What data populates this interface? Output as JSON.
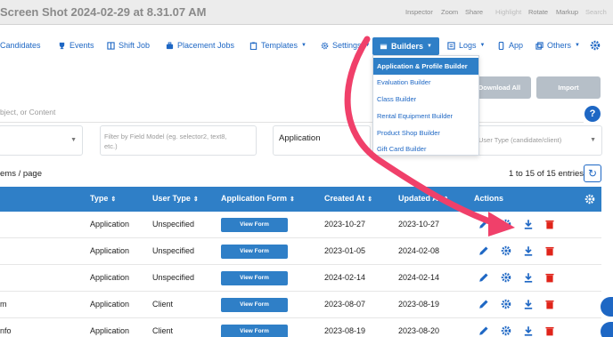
{
  "window": {
    "title": "Screen Shot 2024-02-29 at 8.31.07 AM",
    "toolbar": [
      "Inspector",
      "Zoom",
      "Share",
      "Highlight",
      "Rotate",
      "Markup",
      "Search"
    ]
  },
  "nav": {
    "candidates": "Candidates",
    "events": "Events",
    "shift_job": "Shift Job",
    "placement_jobs": "Placement Jobs",
    "templates": "Templates",
    "settings": "Settings",
    "builders": "Builders",
    "logs": "Logs",
    "app": "App",
    "others": "Others"
  },
  "builders_menu": [
    "Application & Profile Builder",
    "Evaluation Builder",
    "Class Builder",
    "Rental Equipment Builder",
    "Product Shop Builder",
    "Gift Card Builder"
  ],
  "actions": {
    "download_all": "Download All",
    "import": "Import"
  },
  "search": {
    "placeholder_tail": "bject, or Content"
  },
  "filters": {
    "field_model_placeholder": "Filter by Field Model (eg. selector2, text8, etc.)",
    "type_value": "Application",
    "user_type_placeholder": "User Type (candidate/client)"
  },
  "table": {
    "per_page": "ems / page",
    "entries_info": "1 to 15 of 15 entries",
    "headers": [
      "Type",
      "User Type",
      "Application Form",
      "Created At",
      "Updated At",
      "Actions"
    ],
    "view_label": "View Form",
    "rows": [
      {
        "name": "",
        "type": "Application",
        "user_type": "Unspecified",
        "created": "2023-10-27",
        "updated": "2023-10-27"
      },
      {
        "name": "",
        "type": "Application",
        "user_type": "Unspecified",
        "created": "2023-01-05",
        "updated": "2024-02-08"
      },
      {
        "name": "",
        "type": "Application",
        "user_type": "Unspecified",
        "created": "2024-02-14",
        "updated": "2024-02-14"
      },
      {
        "name": "m",
        "type": "Application",
        "user_type": "Client",
        "created": "2023-08-07",
        "updated": "2023-08-19"
      },
      {
        "name": "nfo",
        "type": "Application",
        "user_type": "Client",
        "created": "2023-08-19",
        "updated": "2023-08-20"
      }
    ]
  },
  "colors": {
    "accent": "#2f7fc7",
    "link": "#1e67c4",
    "delete": "#e0241a",
    "annotation_arrow": "#f0406a"
  }
}
